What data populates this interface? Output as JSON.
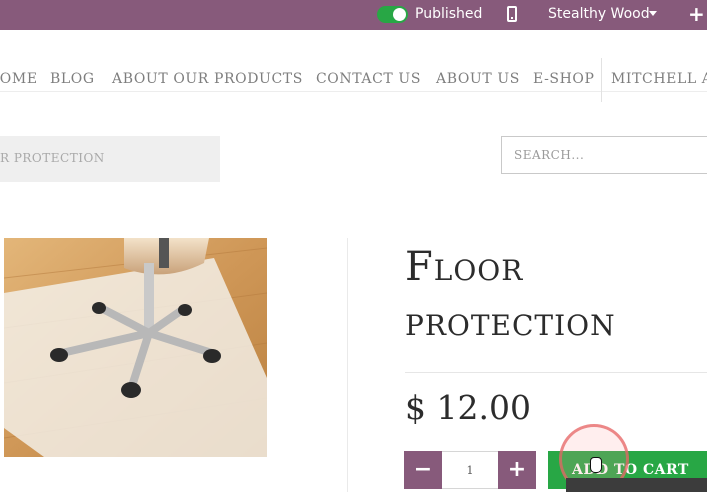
{
  "editbar": {
    "published_label": "Published",
    "published_on": true,
    "theme_label": "Stealthy Wood",
    "icons": [
      "toggle-switch",
      "mobile-icon",
      "caret-down-icon",
      "plus-icon"
    ],
    "plus_symbol": "+"
  },
  "nav": {
    "items": [
      {
        "label": "HOME"
      },
      {
        "label": "BLOG"
      },
      {
        "label": "ABOUT OUR PRODUCTS"
      },
      {
        "label": "CONTACT US"
      },
      {
        "label": "ABOUT US"
      },
      {
        "label": "E-SHOP"
      },
      {
        "label": "MITCHELL ADMIN"
      }
    ]
  },
  "breadcrumb": {
    "text": "FLOOR PROTECTION"
  },
  "search": {
    "placeholder": "SEARCH..."
  },
  "product": {
    "title": "Floor protection",
    "price": "$ 12.00",
    "quantity": "1",
    "minus_symbol": "−",
    "plus_symbol": "+",
    "add_to_cart_label": "ADD TO CART"
  },
  "colors": {
    "brand": "#875A7B",
    "accent_green": "#28a745",
    "nav_text": "#7e7e7e"
  }
}
